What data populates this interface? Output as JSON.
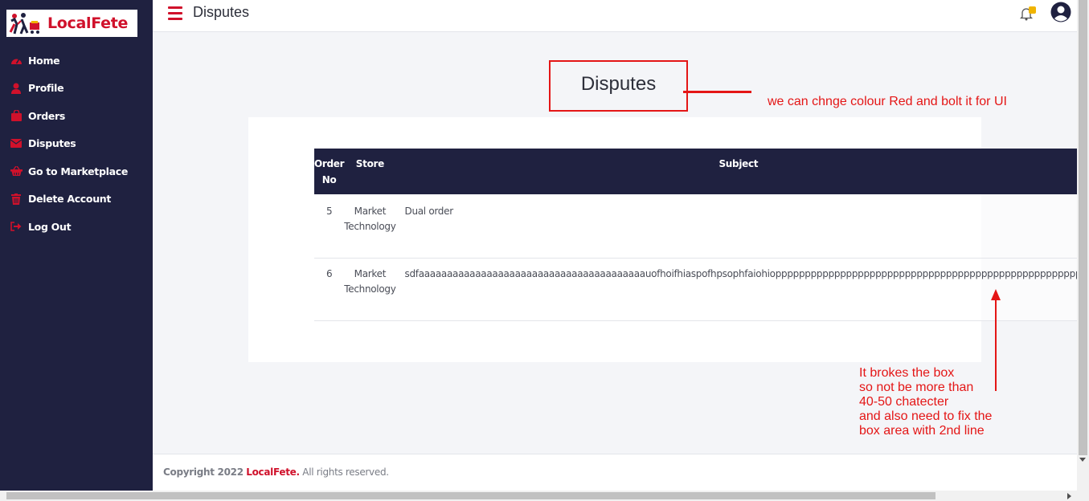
{
  "app": {
    "brand": "LocalFete",
    "accent_color": "#d0112b",
    "sidebar_bg": "#1f2140"
  },
  "topbar": {
    "title": "Disputes"
  },
  "sidebar": {
    "items": [
      {
        "label": "Home",
        "icon": "dashboard-icon"
      },
      {
        "label": "Profile",
        "icon": "user-icon"
      },
      {
        "label": "Orders",
        "icon": "shopping-bag-icon"
      },
      {
        "label": "Disputes",
        "icon": "envelope-icon"
      },
      {
        "label": "Go to Marketplace",
        "icon": "basket-icon"
      },
      {
        "label": "Delete Account",
        "icon": "trash-icon"
      },
      {
        "label": "Log Out",
        "icon": "sign-out-icon"
      }
    ]
  },
  "main": {
    "heading": "Disputes",
    "table": {
      "headers": {
        "order": "Order No",
        "store": "Store",
        "subject": "Subject"
      },
      "rows": [
        {
          "order": "5",
          "store": "Market Technology",
          "subject": "Dual order"
        },
        {
          "order": "6",
          "store": "Market Technology",
          "subject": "sdfaaaaaaaaaaaaaaaaaaaaaaaaaaaaaaaaaaaaaaaauofhoifhiaspofhpsophfaiohiopppppppppppppppppppppppppppppppppppppppppppppppppppp"
        }
      ]
    }
  },
  "annotations": {
    "note1": "we can chnge colour Red and bolt it for UI",
    "note2_lines": [
      "It brokes the box",
      "so not be more than",
      "40-50 chatecter",
      "and also need to fix the",
      "box area with 2nd line"
    ],
    "color": "#e41616"
  },
  "footer": {
    "prefix": "Copyright 2022",
    "brand": "LocalFete.",
    "suffix": "All rights reserved."
  }
}
